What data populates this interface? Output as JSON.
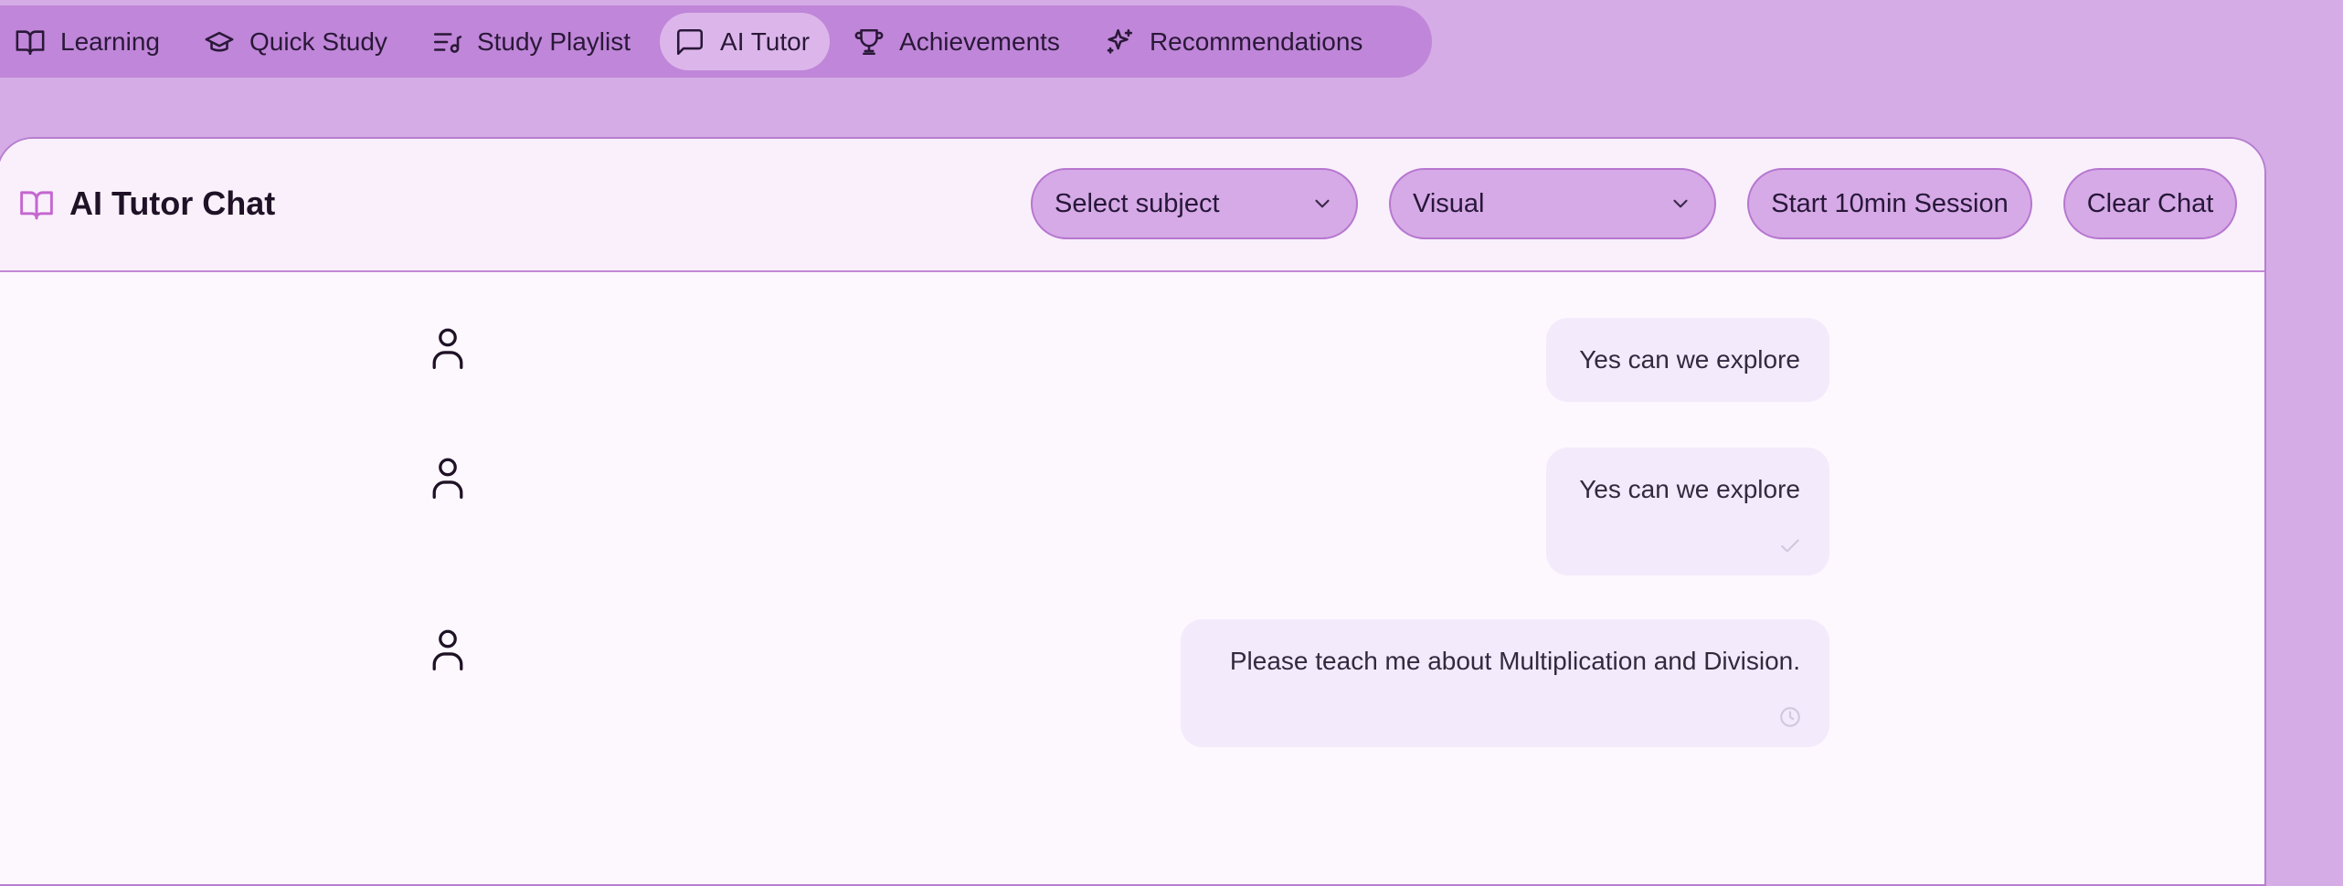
{
  "nav": {
    "items": [
      {
        "label": "Learning",
        "icon": "book-open-icon"
      },
      {
        "label": "Quick Study",
        "icon": "graduation-cap-icon"
      },
      {
        "label": "Study Playlist",
        "icon": "list-music-icon"
      },
      {
        "label": "AI Tutor",
        "icon": "message-square-icon",
        "active": true
      },
      {
        "label": "Achievements",
        "icon": "trophy-icon"
      },
      {
        "label": "Recommendations",
        "icon": "sparkles-icon"
      }
    ]
  },
  "chat": {
    "title": "AI Tutor Chat",
    "subject_select": {
      "value": "Select subject"
    },
    "style_select": {
      "value": "Visual"
    },
    "start_session_label": "Start 10min Session",
    "clear_chat_label": "Clear Chat",
    "messages": [
      {
        "role": "user",
        "text": "Yes can we explore"
      },
      {
        "role": "user",
        "text": "Yes can we explore",
        "status": "check-icon"
      },
      {
        "role": "user",
        "text": "Please teach me about Multiplication and Division.",
        "status": "clock-icon"
      }
    ]
  },
  "colors": {
    "background": "#d5ace6",
    "nav_bar": "#c086d9",
    "nav_active": "#dcb6ea",
    "card": "#fdf8fe",
    "bubble": "#f3eafb",
    "control": "#d6aae6"
  }
}
